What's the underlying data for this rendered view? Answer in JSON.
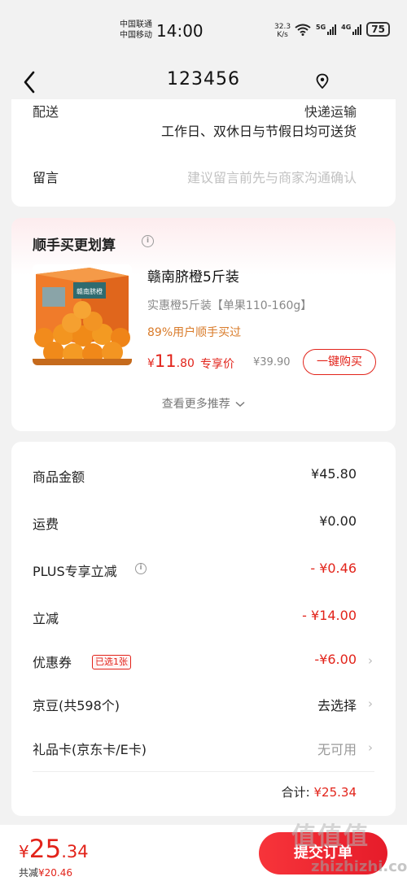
{
  "status_bar": {
    "carrier1": "中国联通",
    "carrier2": "中国移动",
    "time": "14:00",
    "speed_value": "32.3",
    "speed_unit": "K/s",
    "network1": "5G",
    "network2": "4G",
    "battery": "75"
  },
  "header": {
    "title": "123456"
  },
  "delivery": {
    "label_partial": "配送",
    "value_partial": "快递运输",
    "time_text": "工作日、双休日与节假日均可送货",
    "message_label": "留言",
    "message_placeholder": "建议留言前先与商家沟通确认"
  },
  "recommend": {
    "title": "顺手买更划算",
    "product_name": "赣南脐橙5斤装",
    "product_spec": "实惠橙5斤装【单果110-160g】",
    "percent_text": "89%用户顺手买过",
    "price_symbol": "¥",
    "price_int": "11",
    "price_dec": ".80",
    "price_label": "专享价",
    "original_price": "¥39.90",
    "buy_button": "一键购买",
    "more_text": "查看更多推荐",
    "box_text": "赣南脐橙"
  },
  "summary": {
    "rows": [
      {
        "label": "商品金额",
        "value": "¥45.80"
      },
      {
        "label": "运费",
        "value": "¥0.00"
      },
      {
        "label": "PLUS专享立减",
        "value": "- ¥0.46"
      },
      {
        "label": "立减",
        "value": "- ¥14.00"
      },
      {
        "label": "优惠券",
        "badge": "已选1张",
        "value": "-¥6.00"
      },
      {
        "label": "京豆(共598个)",
        "value": "去选择"
      },
      {
        "label": "礼品卡(京东卡/E卡)",
        "value": "无可用"
      }
    ],
    "total_label": "合计:",
    "total_value": "¥25.34"
  },
  "bottom_bar": {
    "price_symbol": "¥",
    "price_int": "25",
    "price_dec": ".34",
    "saved_label": "共减",
    "saved_value": "¥20.46",
    "submit_label": "提交订单"
  },
  "watermark": {
    "text": "值值值",
    "url": "zhizhizhi.com"
  },
  "colors": {
    "accent": "#e2231a",
    "background": "#f2f2f2"
  }
}
